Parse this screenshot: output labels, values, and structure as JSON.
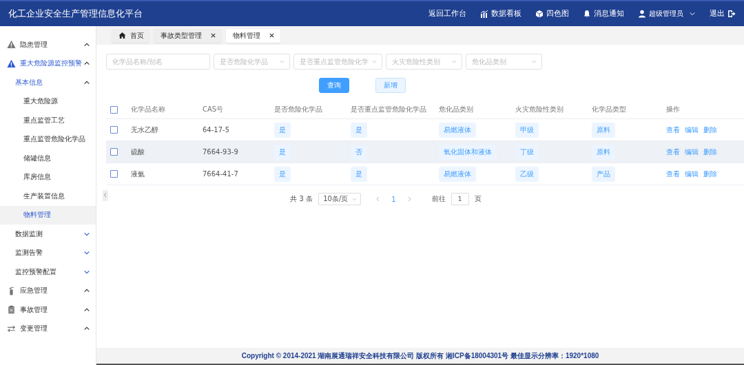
{
  "header": {
    "title": "化工企业安全生产管理信息化平台",
    "nav": [
      {
        "label": "返回工作台"
      },
      {
        "label": "数据看板"
      },
      {
        "label": "四色图"
      },
      {
        "label": "消息通知"
      },
      {
        "label": "超级管理员"
      },
      {
        "label": "退出"
      }
    ]
  },
  "sidebar": {
    "items": [
      {
        "label": "隐患管理",
        "expanded": true,
        "selected": false
      },
      {
        "label": "重大危险源监控预警",
        "expanded": true,
        "selected": false,
        "children": [
          {
            "label": "基本信息",
            "expanded": true,
            "selected": false,
            "children": [
              {
                "label": "重大危险源",
                "selected": false
              },
              {
                "label": "重点监管工艺",
                "selected": false
              },
              {
                "label": "重点监管危险化学品",
                "selected": false
              },
              {
                "label": "储罐信息",
                "selected": false
              },
              {
                "label": "库房信息",
                "selected": false
              },
              {
                "label": "生产装置信息",
                "selected": false
              },
              {
                "label": "物料管理",
                "selected": true
              }
            ]
          },
          {
            "label": "数据监测",
            "expanded": false,
            "selected": false
          },
          {
            "label": "监测告警",
            "expanded": false,
            "selected": false
          },
          {
            "label": "监控预警配置",
            "expanded": false,
            "selected": false
          }
        ]
      },
      {
        "label": "应急管理",
        "expanded": true,
        "selected": false
      },
      {
        "label": "事故管理",
        "expanded": true,
        "selected": false
      },
      {
        "label": "变更管理",
        "expanded": true,
        "selected": false
      }
    ]
  },
  "tabs": [
    {
      "label": "首页",
      "selected": false,
      "closable": false
    },
    {
      "label": "事故类型管理",
      "selected": false,
      "closable": true
    },
    {
      "label": "物料管理",
      "selected": true,
      "closable": true
    }
  ],
  "filters": [
    {
      "kind": "input",
      "placeholder": "化学品名称/别名"
    },
    {
      "kind": "select",
      "placeholder": "是否危险化学品"
    },
    {
      "kind": "select",
      "placeholder": "是否重点监管危险化学"
    },
    {
      "kind": "select",
      "placeholder": "火灾危险性类别"
    },
    {
      "kind": "select",
      "placeholder": "危化品类别"
    }
  ],
  "buttons": [
    {
      "label": "查询",
      "kind": "primary"
    },
    {
      "label": "新增",
      "kind": "plain"
    }
  ],
  "table": {
    "all_checked": false,
    "columns": [
      "化学品名称",
      "CAS号",
      "是否危险化学品",
      "是否重点监管危险化学品",
      "危化品类别",
      "火灾危险性类别",
      "化学品类型",
      "操作"
    ],
    "rows": [
      {
        "checked": false,
        "highlighted": false,
        "name": "无水乙醇",
        "cas": "64-17-5",
        "hazardous": "是",
        "key_supervised": "是",
        "hazard_class": "易燃液体",
        "fire_class": "甲级",
        "chem_type": "原料",
        "actions": [
          "查看",
          "编辑",
          "删除"
        ]
      },
      {
        "checked": false,
        "highlighted": true,
        "name": "硫酸",
        "cas": "7664-93-9",
        "hazardous": "是",
        "key_supervised": "否",
        "hazard_class": "氧化固体和液体",
        "fire_class": "丁级",
        "chem_type": "原料",
        "actions": [
          "查看",
          "编辑",
          "删除"
        ]
      },
      {
        "checked": false,
        "highlighted": false,
        "name": "液氨",
        "cas": "7664-41-7",
        "hazardous": "是",
        "key_supervised": "是",
        "hazard_class": "易燃液体",
        "fire_class": "乙级",
        "chem_type": "产品",
        "actions": [
          "查看",
          "编辑",
          "删除"
        ]
      }
    ]
  },
  "pagination": {
    "total": "共 3 条",
    "page_size": "10条/页",
    "pages": [
      {
        "label": "1",
        "selected": true
      }
    ],
    "goto_label": "前往",
    "goto_value": "1",
    "goto_suffix": "页"
  },
  "footer": "Copyright © 2014-2021 湖南展通瑞祥安全科技有限公司 版权所有 湘ICP备18004301号 最佳显示分辨率：1920*1080"
}
